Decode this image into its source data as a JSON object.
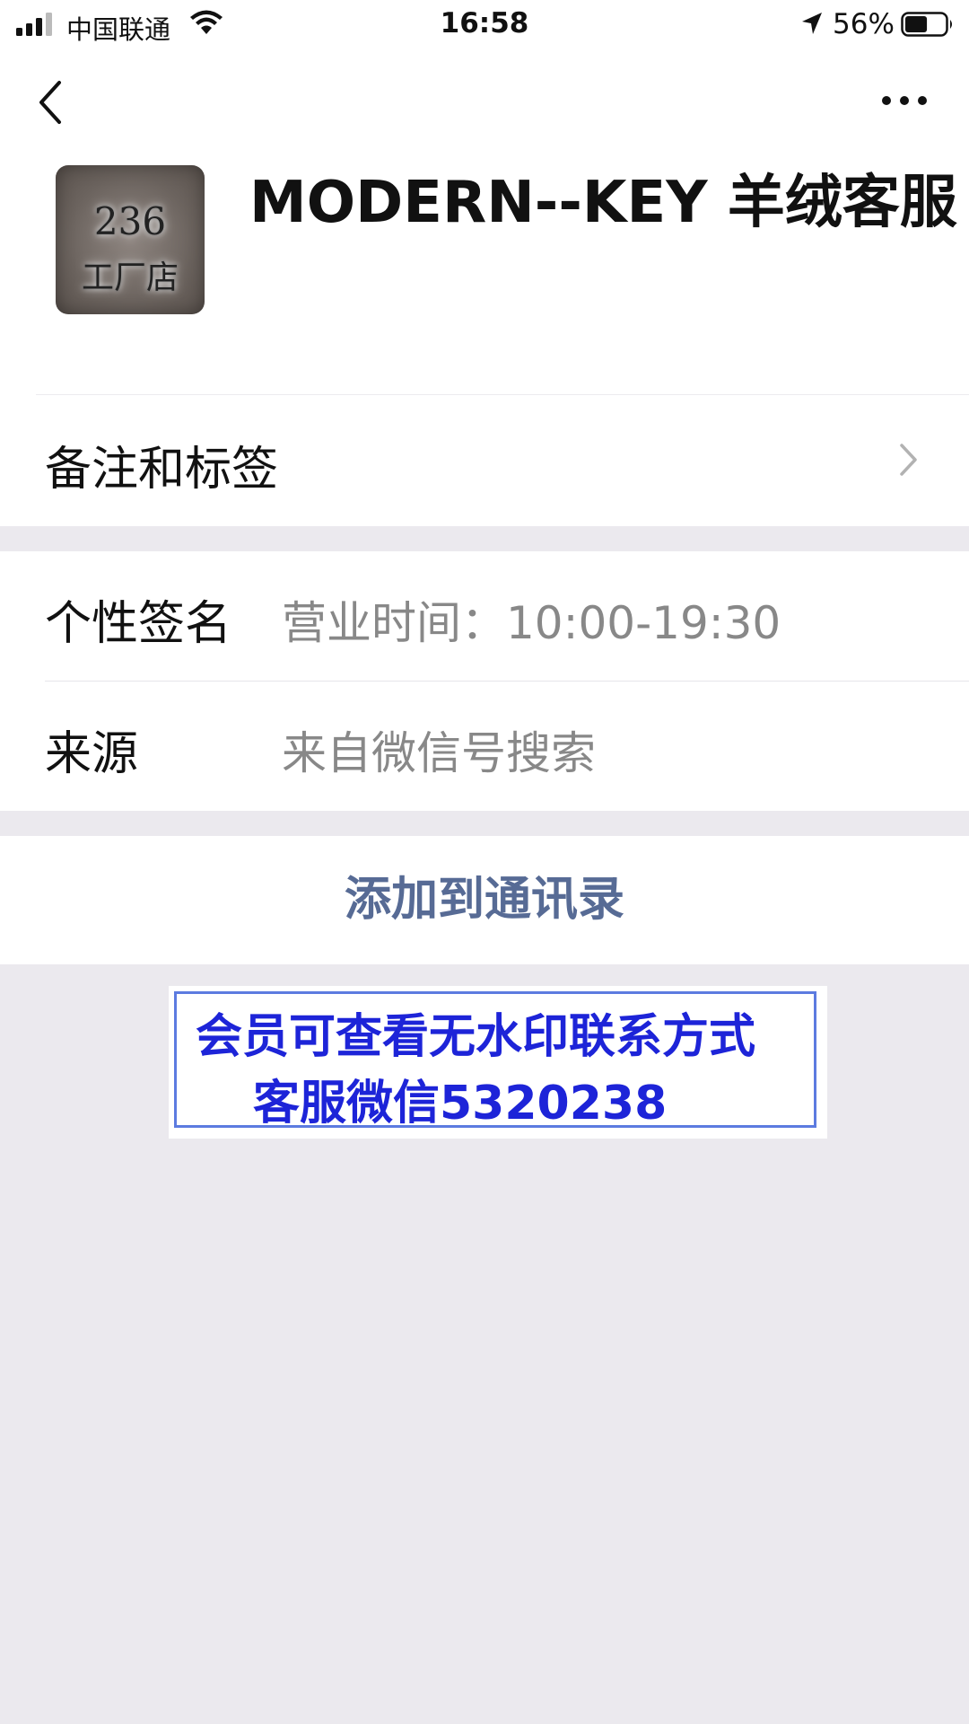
{
  "status_bar": {
    "carrier": "中国联通",
    "time": "16:58",
    "battery_percent": "56%",
    "battery_level": 0.56
  },
  "header": {
    "back_icon": "chevron-left-icon",
    "more_icon": "more-dots-icon",
    "avatar": {
      "line1": "236",
      "line2": "工厂店"
    },
    "contact_name": "MODERN--KEY 羊绒客服"
  },
  "remark_row": {
    "label": "备注和标签",
    "icon": "chevron-right-icon"
  },
  "info": {
    "signature_label": "个性签名",
    "signature_value": "营业时间：10:00-19:30",
    "source_label": "来源",
    "source_value": "来自微信号搜索"
  },
  "action": {
    "add_contact_label": "添加到通讯录"
  },
  "watermark_banner": {
    "line1": "会员可查看无水印联系方式",
    "line2": "客服微信5320238"
  },
  "colors": {
    "link_blue": "#576b95",
    "banner_text": "#1d24d8",
    "page_background": "#ebe9ee"
  }
}
